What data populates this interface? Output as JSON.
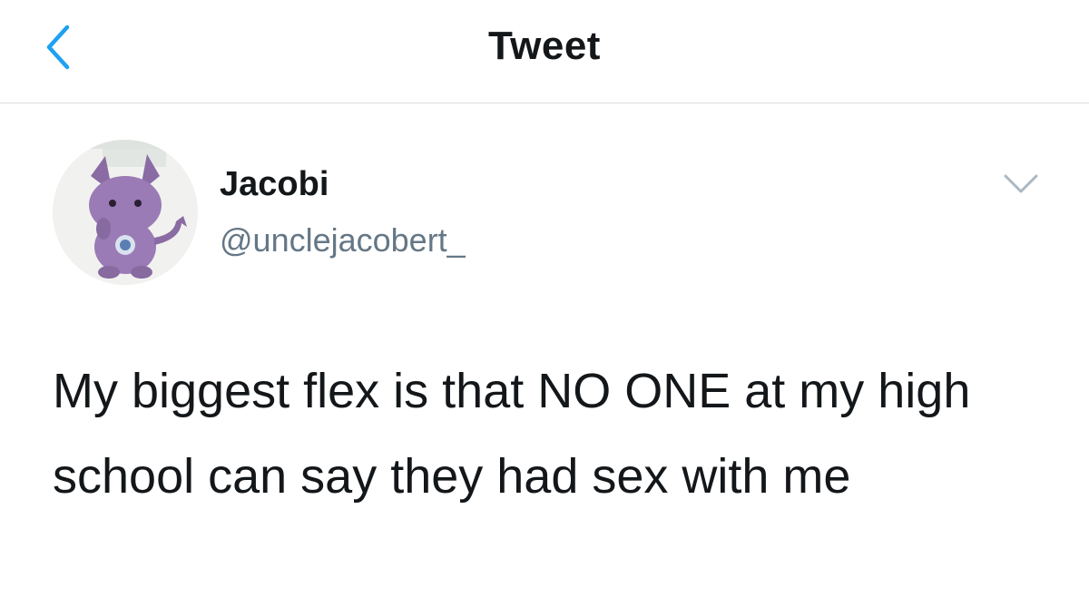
{
  "nav": {
    "title": "Tweet",
    "back_icon": "chevron-left-icon",
    "accent_color": "#1da1f2"
  },
  "tweet": {
    "author": {
      "display_name": "Jacobi",
      "handle": "@unclejacobert_",
      "avatar": "purple-cartoon-creature-avatar"
    },
    "more_icon": "chevron-down-icon",
    "text": "My biggest flex is that NO ONE at my high school can say they had sex with me"
  }
}
